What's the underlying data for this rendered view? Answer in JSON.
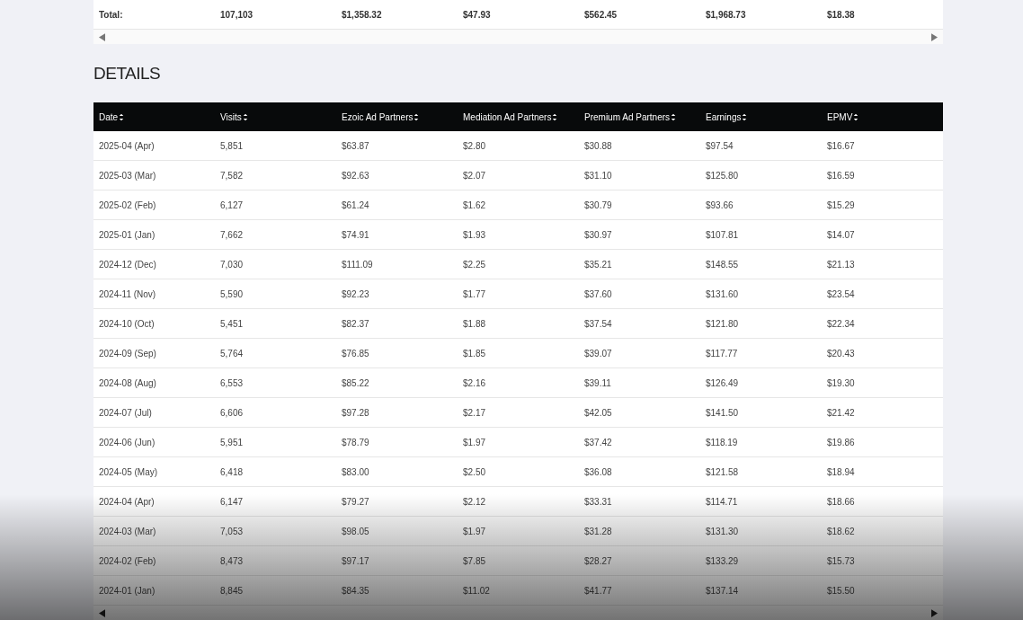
{
  "totals": {
    "label": "Total:",
    "values": [
      "107,103",
      "$1,358.32",
      "$47.93",
      "$562.45",
      "$1,968.73",
      "$18.38"
    ]
  },
  "details": {
    "title": "DETAILS",
    "columns": [
      "Date",
      "Visits",
      "Ezoic Ad Partners",
      "Mediation Ad Partners",
      "Premium Ad Partners",
      "Earnings",
      "EPMV"
    ],
    "rows": [
      [
        "2025-04 (Apr)",
        "5,851",
        "$63.87",
        "$2.80",
        "$30.88",
        "$97.54",
        "$16.67"
      ],
      [
        "2025-03 (Mar)",
        "7,582",
        "$92.63",
        "$2.07",
        "$31.10",
        "$125.80",
        "$16.59"
      ],
      [
        "2025-02 (Feb)",
        "6,127",
        "$61.24",
        "$1.62",
        "$30.79",
        "$93.66",
        "$15.29"
      ],
      [
        "2025-01 (Jan)",
        "7,662",
        "$74.91",
        "$1.93",
        "$30.97",
        "$107.81",
        "$14.07"
      ],
      [
        "2024-12 (Dec)",
        "7,030",
        "$111.09",
        "$2.25",
        "$35.21",
        "$148.55",
        "$21.13"
      ],
      [
        "2024-11 (Nov)",
        "5,590",
        "$92.23",
        "$1.77",
        "$37.60",
        "$131.60",
        "$23.54"
      ],
      [
        "2024-10 (Oct)",
        "5,451",
        "$82.37",
        "$1.88",
        "$37.54",
        "$121.80",
        "$22.34"
      ],
      [
        "2024-09 (Sep)",
        "5,764",
        "$76.85",
        "$1.85",
        "$39.07",
        "$117.77",
        "$20.43"
      ],
      [
        "2024-08 (Aug)",
        "6,553",
        "$85.22",
        "$2.16",
        "$39.11",
        "$126.49",
        "$19.30"
      ],
      [
        "2024-07 (Jul)",
        "6,606",
        "$97.28",
        "$2.17",
        "$42.05",
        "$141.50",
        "$21.42"
      ],
      [
        "2024-06 (Jun)",
        "5,951",
        "$78.79",
        "$1.97",
        "$37.42",
        "$118.19",
        "$19.86"
      ],
      [
        "2024-05 (May)",
        "6,418",
        "$83.00",
        "$2.50",
        "$36.08",
        "$121.58",
        "$18.94"
      ],
      [
        "2024-04 (Apr)",
        "6,147",
        "$79.27",
        "$2.12",
        "$33.31",
        "$114.71",
        "$18.66"
      ],
      [
        "2024-03 (Mar)",
        "7,053",
        "$98.05",
        "$1.97",
        "$31.28",
        "$131.30",
        "$18.62"
      ],
      [
        "2024-02 (Feb)",
        "8,473",
        "$97.17",
        "$7.85",
        "$28.27",
        "$133.29",
        "$15.73"
      ],
      [
        "2024-01 (Jan)",
        "8,845",
        "$84.35",
        "$11.02",
        "$41.77",
        "$137.14",
        "$15.50"
      ]
    ]
  }
}
